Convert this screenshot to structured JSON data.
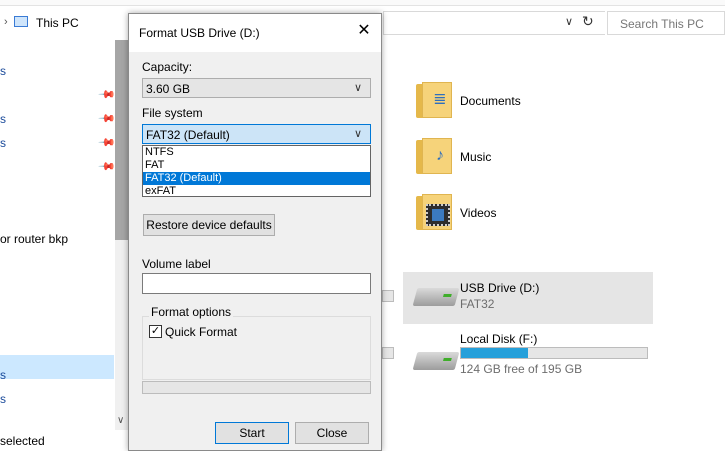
{
  "explorer": {
    "path": "This PC",
    "search_placeholder": "Search This PC",
    "nav_fragments": [
      "s",
      "s",
      "s"
    ],
    "nav_router": "or router bkp",
    "nav_fragments2": [
      "s",
      "s"
    ],
    "status": "selected",
    "folders": [
      {
        "label": "Documents",
        "icon": "documents-folder-icon"
      },
      {
        "label": "Music",
        "icon": "music-folder-icon"
      },
      {
        "label": "Videos",
        "icon": "videos-folder-icon"
      }
    ],
    "drives": [
      {
        "title": "USB Drive (D:)",
        "subtitle": "FAT32"
      },
      {
        "title": "Local Disk (F:)",
        "subtitle": "124 GB free of 195 GB",
        "used_percent": 36
      }
    ]
  },
  "dialog": {
    "title": "Format USB Drive (D:)",
    "capacity_label": "Capacity:",
    "capacity_value": "3.60 GB",
    "filesystem_label": "File system",
    "filesystem_value": "FAT32 (Default)",
    "filesystem_options": [
      "NTFS",
      "FAT",
      "FAT32 (Default)",
      "exFAT"
    ],
    "filesystem_selected_index": 2,
    "restore_button": "Restore device defaults",
    "volume_label": "Volume label",
    "volume_value": "",
    "format_options_label": "Format options",
    "quick_format_label": "Quick Format",
    "quick_format_checked": true,
    "start_button": "Start",
    "close_button": "Close"
  },
  "colors": {
    "accent": "#0078d7",
    "selection": "#cce8ff",
    "drive_bar": "#26a0da"
  }
}
